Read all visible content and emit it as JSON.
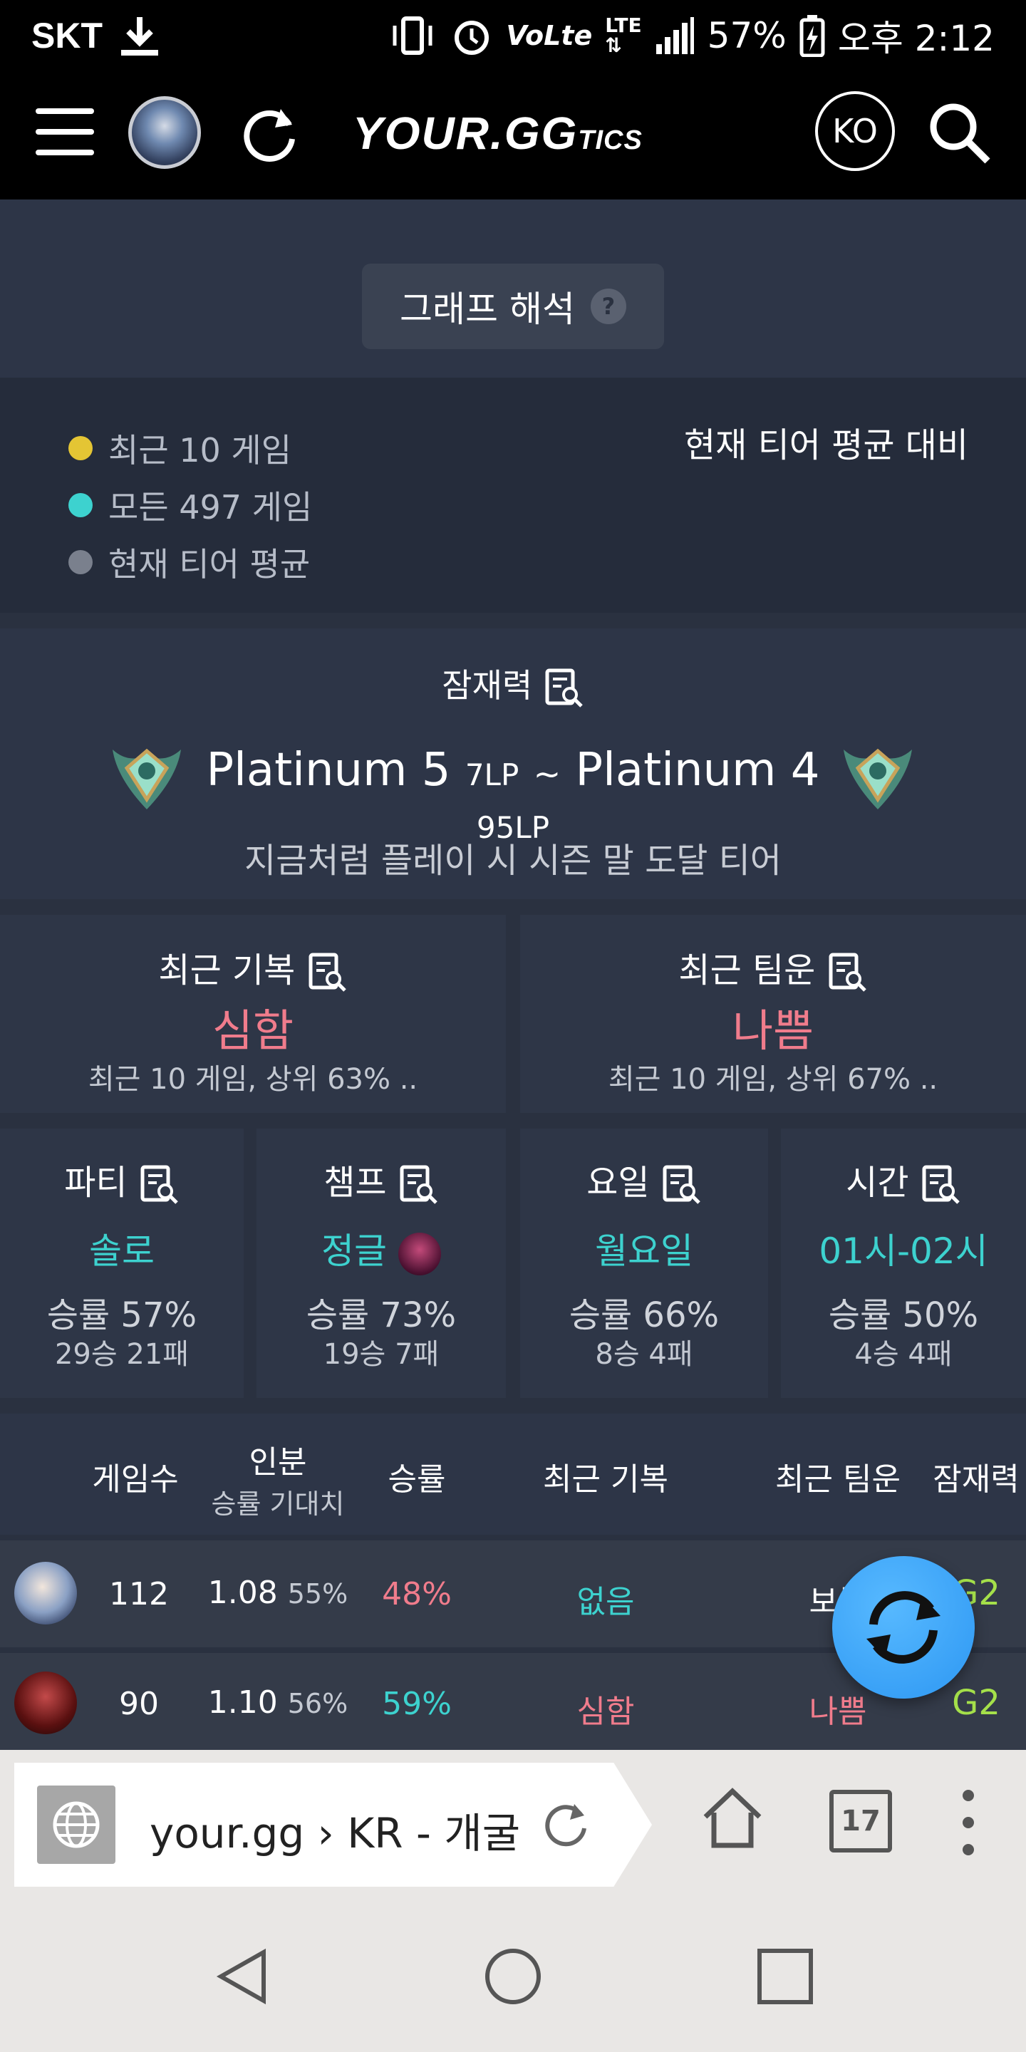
{
  "status_bar": {
    "carrier": "SKT",
    "battery": "57%",
    "time": "오후 2:12"
  },
  "header": {
    "logo": "YOUR.GG",
    "logo_small": "TICS",
    "lang": "KO"
  },
  "graph_help": {
    "label": "그래프 해석"
  },
  "legend": {
    "items": [
      {
        "label": "최근 10 게임",
        "color": "#e4c534"
      },
      {
        "label": "모든 497 게임",
        "color": "#3dd2cf"
      },
      {
        "label": "현재 티어 평균",
        "color": "#7a808d"
      }
    ],
    "compare_label": "현재 티어 평균 대비"
  },
  "potential": {
    "title": "잠재력",
    "tier_from": "Platinum 5",
    "lp_from": "7LP",
    "sep": "~",
    "tier_to": "Platinum 4",
    "lp_to": "95LP",
    "caption": "지금처럼 플레이 시 시즌 말 도달 티어"
  },
  "recent": [
    {
      "title": "최근 기복",
      "value": "심함",
      "sub": "최근 10 게임, 상위 63% ..",
      "color": "#f07c8c"
    },
    {
      "title": "최근 팀운",
      "value": "나쁨",
      "sub": "최근 10 게임, 상위 67% ..",
      "color": "#f07c8c"
    }
  ],
  "stats": [
    {
      "title": "파티",
      "value": "솔로",
      "rate": "승률 57%",
      "record": "29승 21패"
    },
    {
      "title": "챔프",
      "value": "정글",
      "rate": "승률 73%",
      "record": "19승 7패"
    },
    {
      "title": "요일",
      "value": "월요일",
      "rate": "승률 66%",
      "record": "8승 4패"
    },
    {
      "title": "시간",
      "value": "01시-02시",
      "rate": "승률 50%",
      "record": "4승 4패"
    }
  ],
  "table": {
    "headers": {
      "games": "게임수",
      "carry": "인분",
      "carry_sub": "승률 기대치",
      "winrate": "승률",
      "swing": "최근 기복",
      "luck": "최근 팀운",
      "potential": "잠재력"
    },
    "rows": [
      {
        "games": "112",
        "carry": "1.08",
        "expect": "55%",
        "winrate": "48%",
        "swing": "없음",
        "luck": "보통",
        "potential": "G2"
      },
      {
        "games": "90",
        "carry": "1.10",
        "expect": "56%",
        "winrate": "59%",
        "swing": "심함",
        "luck": "나쁨",
        "potential": "G2"
      }
    ]
  },
  "browser": {
    "url": "your.gg › KR - 개굴는",
    "tabs": "17"
  }
}
